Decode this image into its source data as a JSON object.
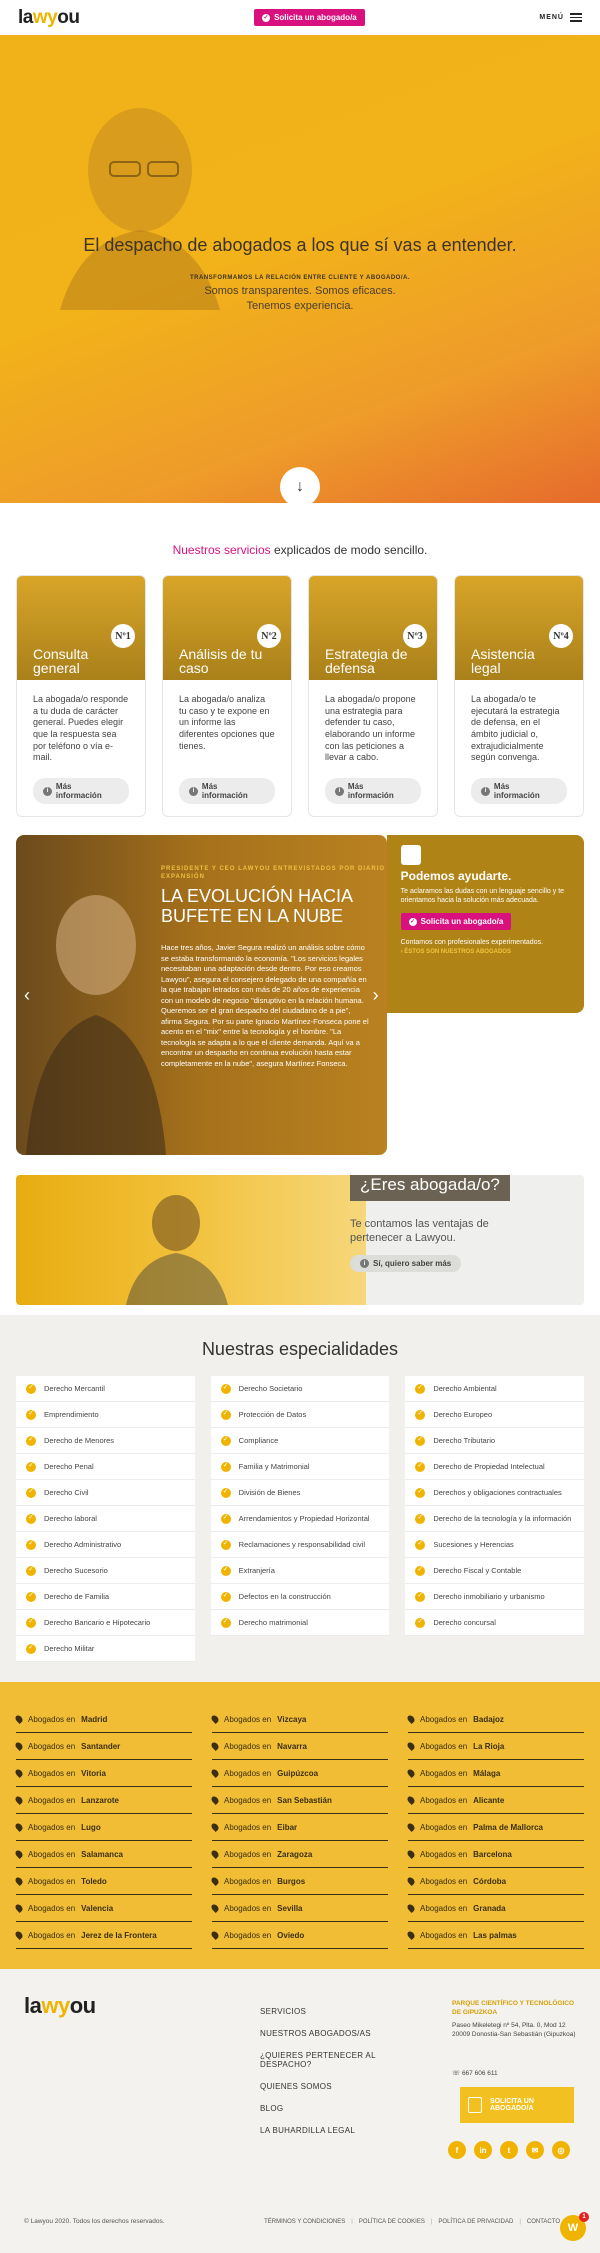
{
  "header": {
    "logo_pre": "la",
    "logo_y": "wy",
    "logo_post": "ou",
    "cta": "Solicita un abogado/a",
    "menu": "MENÚ"
  },
  "hero": {
    "title": "El despacho de abogados a los que sí vas a entender.",
    "tagline": "TRANSFORMAMOS LA RELACIÓN ENTRE CLIENTE Y ABOGADO/A.",
    "line2": "Somos transparentes. Somos eficaces.",
    "line3": "Tenemos experiencia."
  },
  "services": {
    "title_highlight": "Nuestros servicios",
    "title_rest": " explicados de modo sencillo.",
    "more": "Más información",
    "items": [
      {
        "title": "Consulta general",
        "num": "Nº1",
        "desc": "La abogada/o responde a tu duda de carácter general. Puedes elegir que la respuesta sea por teléfono o vía e-mail."
      },
      {
        "title": "Análisis de tu caso",
        "num": "Nº2",
        "desc": "La abogada/o analiza tu caso y te expone en un informe las diferentes opciones que tienes."
      },
      {
        "title": "Estrategia de defensa",
        "num": "Nº3",
        "desc": "La abogada/o propone una estrategia para defender tu caso, elaborando un informe con las peticiones a llevar a cabo."
      },
      {
        "title": "Asistencia legal",
        "num": "Nº4",
        "desc": "La abogada/o te ejecutará la estrategia de defensa, en el ámbito judicial o, extrajudicialmente según convenga."
      }
    ]
  },
  "story": {
    "kicker": "PRESIDENTE Y CEO LAWYOU ENTREVISTADOS POR DIARIO EXPANSIÓN",
    "title": "LA EVOLUCIÓN HACIA BUFETE EN LA NUBE",
    "text": "Hace tres años, Javier Segura realizó un análisis sobre cómo se estaba transformando la economía. \"Los servicios legales necesitaban una adaptación desde dentro. Por eso creamos Lawyou\", asegura el consejero delegado de una compañía en la que trabajan letrados con más de 20 años de experiencia con un modelo de negocio \"disruptivo en la relación humana. Queremos ser el gran despacho del ciudadano de a pie\", afirma Segura. Por su parte Ignacio Martínez-Fonseca pone el acento en el \"mix\" entre la tecnología y el hombre. \"La tecnología se adapta a lo que el cliente demanda. Aquí va a encontrar un despacho en continua evolución hasta estar completamente en la nube\", asegura Martínez Fonseca.",
    "prev": "‹",
    "next": "›",
    "side_title": "Podemos ayudarte.",
    "side_text": "Te aclaramos las dudas con un lenguaje sencillo y te orientamos hacia la solución más adecuada.",
    "side_cta": "Solicita un abogado/a",
    "side_text2": "Contamos con profesionales experimentados.",
    "side_link": "› ÉSTOS SON NUESTROS ABOGADOS"
  },
  "abog": {
    "question": "¿Eres abogada/o?",
    "sub": "Te contamos las ventajas de pertenecer a Lawyou.",
    "more": "Sí, quiero saber más"
  },
  "specialties": {
    "title": "Nuestras especialidades",
    "col1": [
      "Derecho Mercantil",
      "Emprendimiento",
      "Derecho de Menores",
      "Derecho Penal",
      "Derecho Civil",
      "Derecho laboral",
      "Derecho Administrativo",
      "Derecho Sucesorio",
      "Derecho de Familia",
      "Derecho Bancario e Hipotecario",
      "Derecho Militar"
    ],
    "col2": [
      "Derecho Societario",
      "Protección de Datos",
      "Compliance",
      "Familia y Matrimonial",
      "División de Bienes",
      "Arrendamientos y Propiedad Horizontal",
      "Reclamaciones y responsabilidad civil",
      "Extranjería",
      "Defectos en la construcción",
      "Derecho matrimonial"
    ],
    "col3": [
      "Derecho Ambiental",
      "Derecho Europeo",
      "Derecho Tributario",
      "Derecho de Propiedad Intelectual",
      "Derechos y obligaciones contractuales",
      "Derecho de la tecnología y la información",
      "Sucesiones y Herencias",
      "Derecho Fiscal y Contable",
      "Derecho inmobiliario y urbanismo",
      "Derecho concursal"
    ]
  },
  "cities": {
    "prefix": "Abogados en",
    "col1": [
      "Madrid",
      "Santander",
      "Vitoria",
      "Lanzarote",
      "Lugo",
      "Salamanca",
      "Toledo",
      "Valencia",
      "Jerez de la Frontera"
    ],
    "col2": [
      "Vizcaya",
      "Navarra",
      "Guipúzcoa",
      "San Sebastián",
      "Eibar",
      "Zaragoza",
      "Burgos",
      "Sevilla",
      "Oviedo"
    ],
    "col3": [
      "Badajoz",
      "La Rioja",
      "Málaga",
      "Alicante",
      "Palma de Mallorca",
      "Barcelona",
      "Córdoba",
      "Granada",
      "Las palmas"
    ]
  },
  "footer": {
    "links": [
      "SERVICIOS",
      "NUESTROS ABOGADOS/AS",
      "¿QUIERES PERTENECER AL DESPACHO?",
      "QUIENES SOMOS",
      "BLOG",
      "LA BUHARDILLA LEGAL"
    ],
    "addr_head": "PARQUE CIENTÍFICO Y TECNOLÓGICO DE GIPUZKOA",
    "addr": "Paseo Mikeletegi nº 54, Plta. 0, Mod 12 20009 Donostia-San Sebastián (Gipuzkoa)",
    "phone": "667 606 611",
    "cta": "SOLICITA UN ABOGADO/A",
    "social": [
      "f",
      "in",
      "t",
      "✉",
      "◎"
    ],
    "copyright": "© Lawyou 2020. Todos los derechos reservados.",
    "legal": [
      "TÉRMINOS Y CONDICIONES",
      "POLÍTICA DE COOKIES",
      "POLÍTICA DE PRIVACIDAD",
      "CONTACTO"
    ],
    "float_letter": "W",
    "float_badge": "1"
  }
}
